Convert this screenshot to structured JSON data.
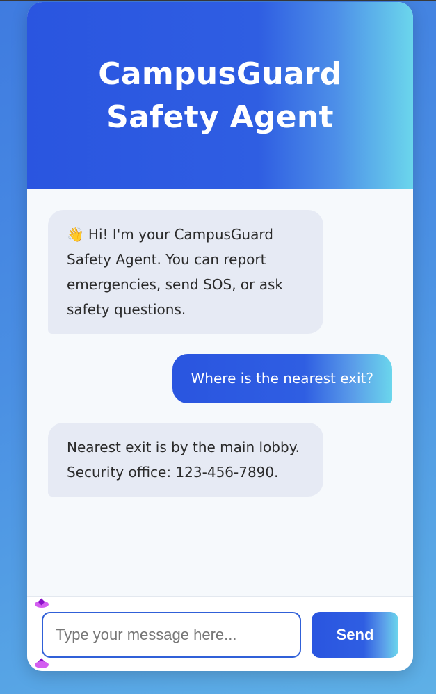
{
  "header": {
    "title": "CampusGuard Safety Agent"
  },
  "messages": [
    {
      "sender": "bot",
      "emoji": "👋",
      "text": "Hi! I'm your CampusGuard Safety Agent. You can report emergencies, send SOS, or ask safety questions."
    },
    {
      "sender": "user",
      "text": "Where is the nearest exit?"
    },
    {
      "sender": "bot",
      "text": "Nearest exit is by the main lobby. Security office: 123-456-7890."
    }
  ],
  "composer": {
    "placeholder": "Type your message here...",
    "value": "",
    "send_label": "Send"
  },
  "colors": {
    "accent": "#2a55e0",
    "accent_light": "#6bd6ec",
    "bot_bubble": "#e6eaf4",
    "background": "#4a8fe3"
  },
  "icons": {
    "greeting": "waving-hand-icon",
    "resize": "resize-handle-icon"
  }
}
